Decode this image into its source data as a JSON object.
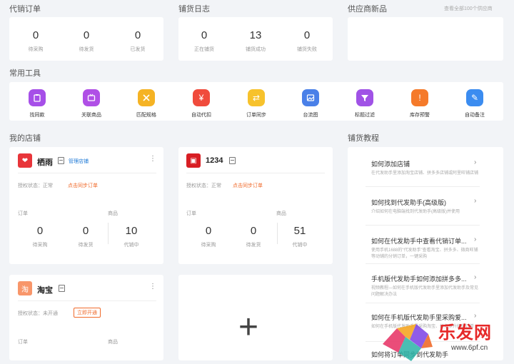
{
  "sections": {
    "orders": "代销订单",
    "logs": "铺货日志",
    "supplier": "供应商新品",
    "supplier_link": "查看全部100个供应商",
    "tools": "常用工具",
    "stores": "我的店铺",
    "tutorial": "铺货教程"
  },
  "orders_stats": [
    {
      "value": "0",
      "label": "待采购"
    },
    {
      "value": "0",
      "label": "待发货"
    },
    {
      "value": "0",
      "label": "已发货"
    }
  ],
  "log_stats": [
    {
      "value": "0",
      "label": "正在铺货"
    },
    {
      "value": "13",
      "label": "铺货成功"
    },
    {
      "value": "0",
      "label": "铺货失败"
    }
  ],
  "tools": [
    {
      "label": "找同款",
      "icon": "clipboard-icon",
      "color": "#a64fe8"
    },
    {
      "label": "关联商品",
      "icon": "tv-icon",
      "color": "#b04fe6"
    },
    {
      "label": "匹配规格",
      "icon": "tools-icon",
      "color": "#f5b324"
    },
    {
      "label": "自动代扣",
      "icon": "yen-icon",
      "color": "#f04b3c"
    },
    {
      "label": "订单同步",
      "icon": "sync-icon",
      "color": "#f7c22c"
    },
    {
      "label": "台流图",
      "icon": "image-icon",
      "color": "#4a80e8"
    },
    {
      "label": "标题过滤",
      "icon": "filter-icon",
      "color": "#a052e6"
    },
    {
      "label": "库存预警",
      "icon": "alert-icon",
      "color": "#f57a2a"
    },
    {
      "label": "自动备注",
      "icon": "edit-icon",
      "color": "#3b8cf0"
    }
  ],
  "stores": [
    {
      "name": "栖雨",
      "manage": "管理店铺",
      "auth": "授权状态：正常",
      "sync": "点击同步订单",
      "orders_label": "订单",
      "goods_label": "商品",
      "stats": [
        {
          "value": "0",
          "label": "待采购"
        },
        {
          "value": "0",
          "label": "待发货"
        },
        {
          "value": "10",
          "label": "代销中"
        }
      ],
      "more": "⋮"
    },
    {
      "name": "1234",
      "auth": "授权状态：正常",
      "sync": "点击同步订单",
      "orders_label": "订单",
      "goods_label": "商品",
      "stats": [
        {
          "value": "0",
          "label": "待采购"
        },
        {
          "value": "0",
          "label": "待发货"
        },
        {
          "value": "51",
          "label": "代销中"
        }
      ]
    },
    {
      "name": "淘宝",
      "auth": "授权状态：未开通",
      "open": "立即开通",
      "orders_label": "订单",
      "goods_label": "商品",
      "more": "⋮"
    }
  ],
  "add_store": "+",
  "tutorials": [
    {
      "title": "如何添加店铺",
      "desc": "在代发助手里添加淘宝店铺、拼多多店铺或阿里旺铺店铺"
    },
    {
      "title": "如何找到代发助手(高级版)",
      "desc": "介绍如何在电脑端找到代发助手(高级版)并使用"
    },
    {
      "title": "如何在代发助手中查看代销订单...",
      "desc": "使用手机1688的\"代发助手\"查看淘宝、拼多多、微商旺铺等动铺的分销订单，一键采购"
    },
    {
      "title": "手机版代发助手如何添加拼多多...",
      "desc": "视频教程—如何在手机版代发助手里添加代发助手及常见问题解决办法"
    },
    {
      "title": "如何在手机版代发助手里采购爱...",
      "desc": "如何在手机版代发助手里采购淘宝、拼多多升级的订单"
    },
    {
      "title": "如何将订单同步到代发助手",
      "desc": ""
    }
  ],
  "watermark": {
    "brand": "乐发网",
    "url": "www.6pf.cn"
  }
}
